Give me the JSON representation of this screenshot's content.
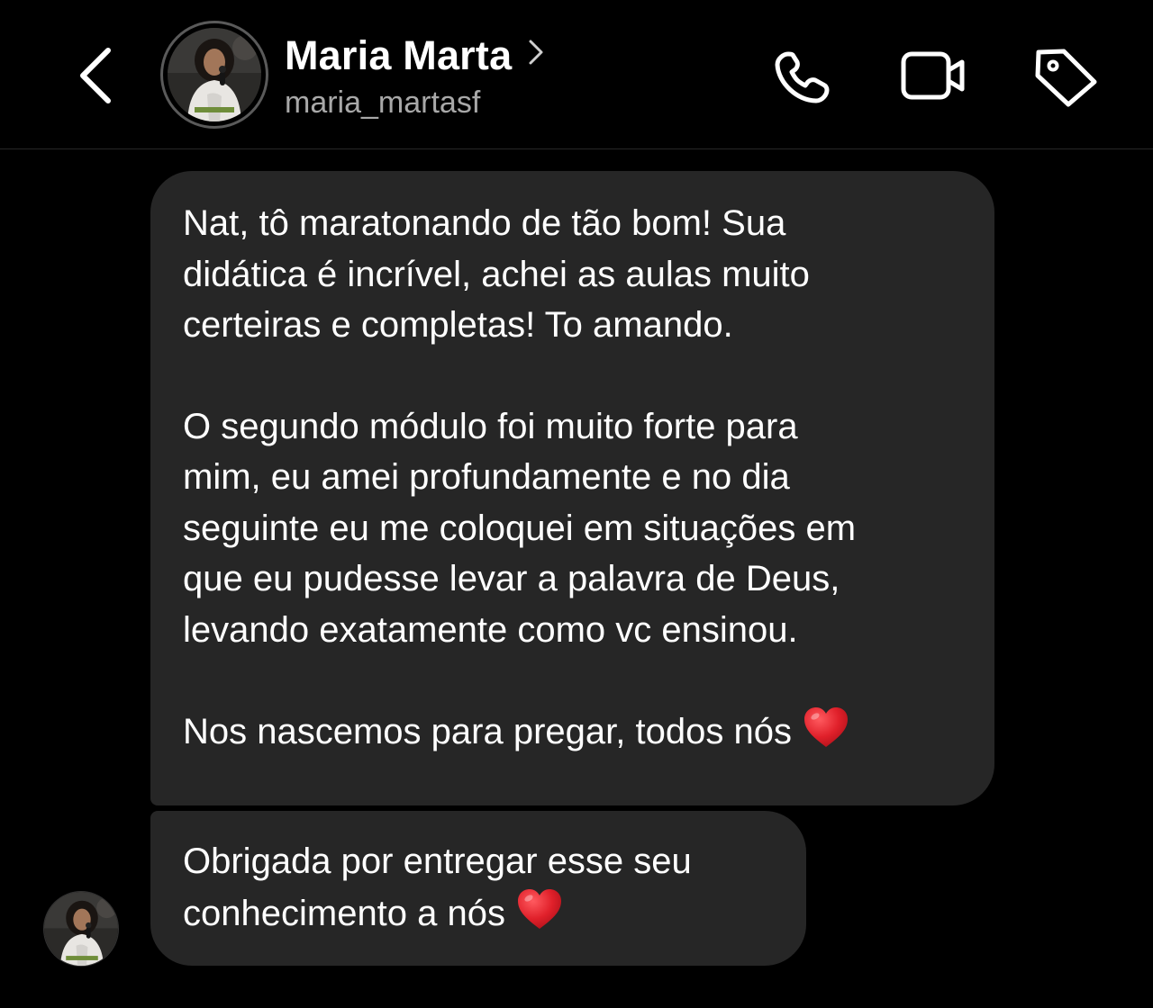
{
  "header": {
    "back_icon": "chevron-left-icon",
    "avatar_icon": "profile-photo",
    "name": "Maria Marta",
    "name_chevron_icon": "chevron-right-icon",
    "username": "maria_martasf",
    "actions": {
      "call_icon": "phone-icon",
      "video_icon": "video-camera-icon",
      "tag_icon": "tag-icon"
    }
  },
  "messages": [
    {
      "paragraphs": [
        "Nat, tô maratonando de tão bom! Sua\ndidática é incrível, achei as aulas muito\ncerteiras e completas! To amando.",
        "O segundo módulo foi muito forte para\nmim, eu amei profundamente e no dia\nseguinte eu me coloquei em situações em\nque eu pudesse levar a palavra de Deus,\nlevando exatamente como vc ensinou.",
        "Nos nascemos para pregar, todos nós"
      ],
      "trailing_emoji": "red-heart-icon"
    },
    {
      "paragraphs": [
        "Obrigada por entregar esse seu\nconhecimento a nós"
      ],
      "trailing_emoji": "red-heart-icon"
    }
  ],
  "colors": {
    "background": "#000000",
    "bubble": "#262626",
    "text_primary": "#ffffff",
    "text_secondary": "#a8a8a8",
    "heart": "#e0202a"
  }
}
